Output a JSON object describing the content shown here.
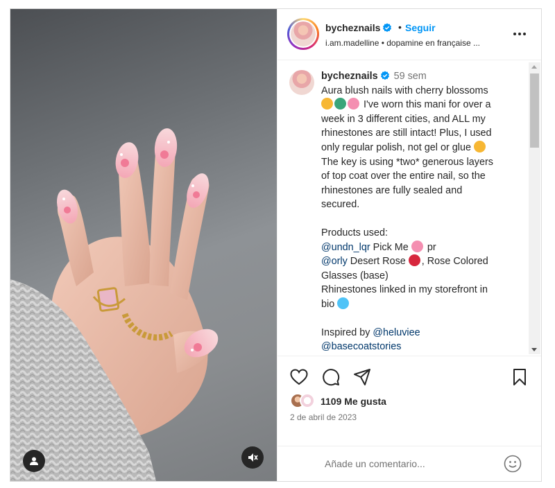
{
  "post": {
    "header": {
      "username": "bycheznails",
      "separator": "•",
      "follow_label": "Seguir",
      "subtitle": "i.am.madelline • dopamine en française ..."
    },
    "caption": {
      "username": "bycheznails",
      "time": "59 sem",
      "lines": [
        "Aura blush nails with cherry blossoms",
        "I've worn this mani for over a",
        "week in 3 different cities, and ALL my",
        "rhinestones are still intact! Plus, I used",
        "only regular polish, not gel or glue",
        "The key is using *two* generous layers",
        "of top coat over the entire nail, so the",
        "rhinestones are fully sealed and",
        "secured."
      ],
      "products_title": "Products used:",
      "product_1_mention": "@undn_lqr",
      "product_1_text": "Pick Me",
      "product_1_suffix": "pr",
      "product_2_mention": "@orly",
      "product_2_text": "Desert Rose",
      "product_2_suffix": ", Rose Colored",
      "product_2_line2": "Glasses (base)",
      "rhinestones_line1": "Rhinestones linked in my storefront in",
      "rhinestones_line2": "bio",
      "inspired_prefix": "Inspired by",
      "inspired_mention_1": "@heluviee",
      "inspired_mention_2": "@basecoatstories"
    },
    "likes": {
      "count": "1109",
      "label": "Me gusta"
    },
    "date": "2 de abril de 2023",
    "comment": {
      "placeholder": "Añade un comentario..."
    }
  },
  "icons": {
    "verified": "verified-badge-icon",
    "more": "more-options-icon",
    "like": "heart-icon",
    "comment": "comment-icon",
    "share": "share-icon",
    "save": "bookmark-icon",
    "emoji": "emoji-icon",
    "user_tag": "user-tag-icon",
    "mute": "muted-speaker-icon"
  },
  "colors": {
    "accent": "#0095f6",
    "verified": "#0095f6",
    "mention": "#00376b",
    "muted_text": "#737373"
  }
}
